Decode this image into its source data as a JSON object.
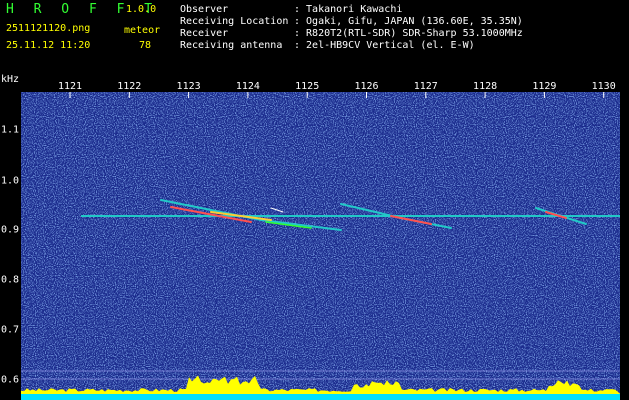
{
  "header": {
    "logo": "H R O F F T",
    "version": "1.0.0",
    "filename": "2511121120.png",
    "detection_label": "meteor",
    "datetime": "25.11.12 11:20",
    "detection_count": "78"
  },
  "info": {
    "observer_label": "Observer",
    "observer_value": ": Takanori Kawachi",
    "location_label": "Receiving Location",
    "location_value": ": Ogaki, Gifu, JAPAN (136.60E, 35.35N)",
    "receiver_label": "Receiver",
    "receiver_value": ": R820T2(RTL-SDR) SDR-Sharp 53.1000MHz",
    "antenna_label": "Receiving antenna",
    "antenna_value": ": 2el-HB9CV Vertical (el. E-W)"
  },
  "axes": {
    "y_unit": "kHz",
    "x_ticks": [
      "1121",
      "1122",
      "1123",
      "1124",
      "1125",
      "1126",
      "1127",
      "1128",
      "1129",
      "1130"
    ],
    "y_ticks": [
      "1.1",
      "1.0",
      "0.9",
      "0.8",
      "0.7",
      "0.6"
    ]
  },
  "colors": {
    "background": "#1a2a8c",
    "trace": "#22c8c8",
    "hot": "#ff3030",
    "level": "#ffff00",
    "cyan_base": "#00e0ff"
  }
}
